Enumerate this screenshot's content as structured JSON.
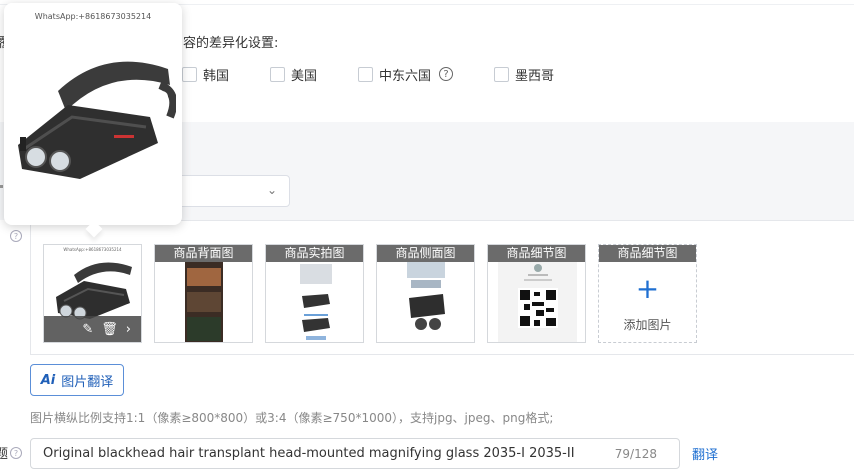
{
  "diff_settings": {
    "cut_char": "覆",
    "text": "容的差异化设置:"
  },
  "countries": [
    {
      "label": "韩国"
    },
    {
      "label": "美国"
    },
    {
      "label": "中东六国",
      "help": "?"
    },
    {
      "label": "墨西哥"
    }
  ],
  "popup": {
    "watermark": "WhatsApp:+8618673035214"
  },
  "thumb_main": {
    "watermark": "WhatsApp:+8618673035214"
  },
  "images": [
    {
      "label": "商品背面图"
    },
    {
      "label": "商品实拍图"
    },
    {
      "label": "商品侧面图"
    },
    {
      "label": "商品细节图"
    }
  ],
  "add_image": {
    "label": "商品细节图",
    "plus": "+",
    "text": "添加图片"
  },
  "translate_button": {
    "ai": "Ai",
    "label": "图片翻译"
  },
  "hint": "图片横纵比例支持1:1（像素≥800*800）或3:4（像素≥750*1000），支持jpg、jpeg、png格式;",
  "title_field": {
    "cut_char": "题",
    "value": "Original blackhead hair transplant head-mounted magnifying glass 2035-I 2035-II",
    "counter": "79/128"
  },
  "translate_link": "翻译",
  "icons": {
    "edit": "pencil-icon",
    "delete": "trash-icon",
    "next": "chevron-right-icon",
    "dropdown": "chevron-down-icon"
  }
}
